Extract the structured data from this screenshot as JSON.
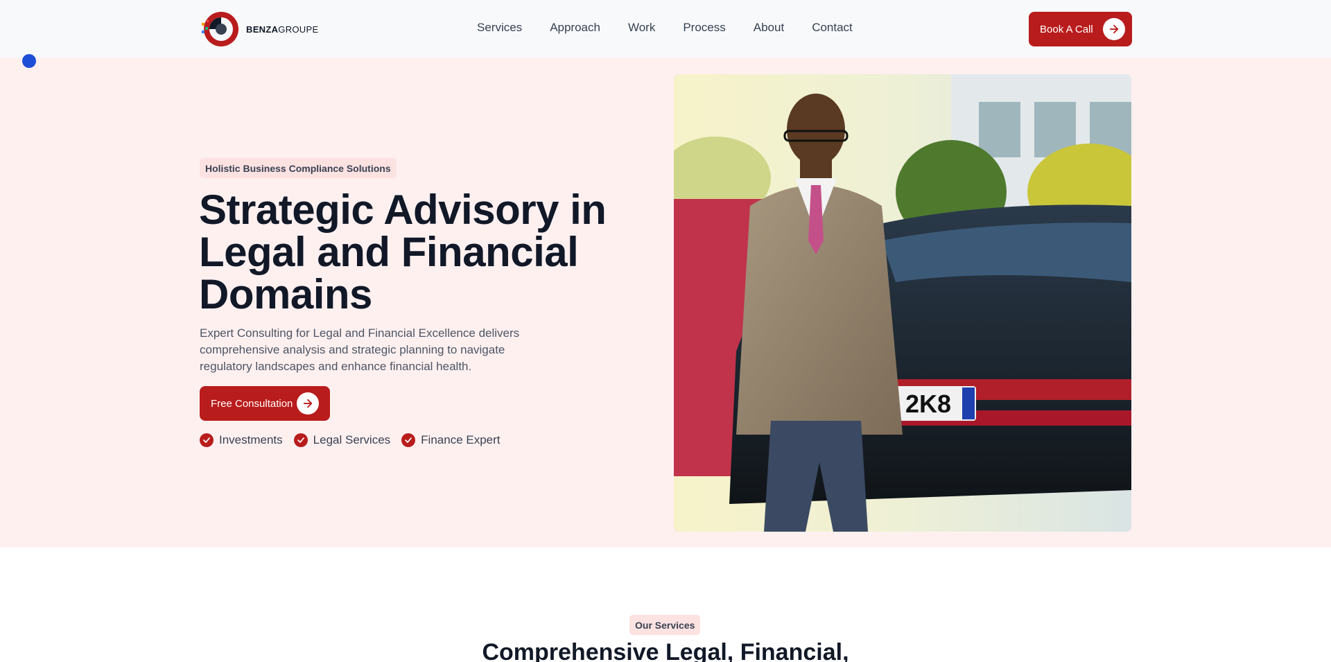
{
  "brand": {
    "name_bold": "BENZA",
    "name_regular": "GROUPE"
  },
  "nav": {
    "items": [
      {
        "label": "Services"
      },
      {
        "label": "Approach"
      },
      {
        "label": "Work"
      },
      {
        "label": "Process"
      },
      {
        "label": "About"
      },
      {
        "label": "Contact"
      }
    ]
  },
  "header": {
    "cta_label": "Book A Call"
  },
  "hero": {
    "badge": "Holistic Business Compliance Solutions",
    "title": "Strategic Advisory in Legal and Financial Domains",
    "subtitle": "Expert Consulting for Legal and Financial Excellence delivers comprehensive analysis and strategic planning to navigate regulatory landscapes and enhance financial health.",
    "cta_label": "Free Consultation",
    "features": [
      {
        "label": "Investments"
      },
      {
        "label": "Legal Services"
      },
      {
        "label": "Finance Expert"
      }
    ],
    "photo_plate": "2K8"
  },
  "services": {
    "badge": "Our Services",
    "title": "Comprehensive Legal, Financial,"
  },
  "colors": {
    "accent": "#b91c1c",
    "hero_bg": "#fff0f0",
    "badge_bg": "#fde2e2",
    "indicator": "#1d4ed8"
  },
  "icons": {
    "arrow": "arrow-right-icon",
    "check": "check-circle-icon"
  }
}
